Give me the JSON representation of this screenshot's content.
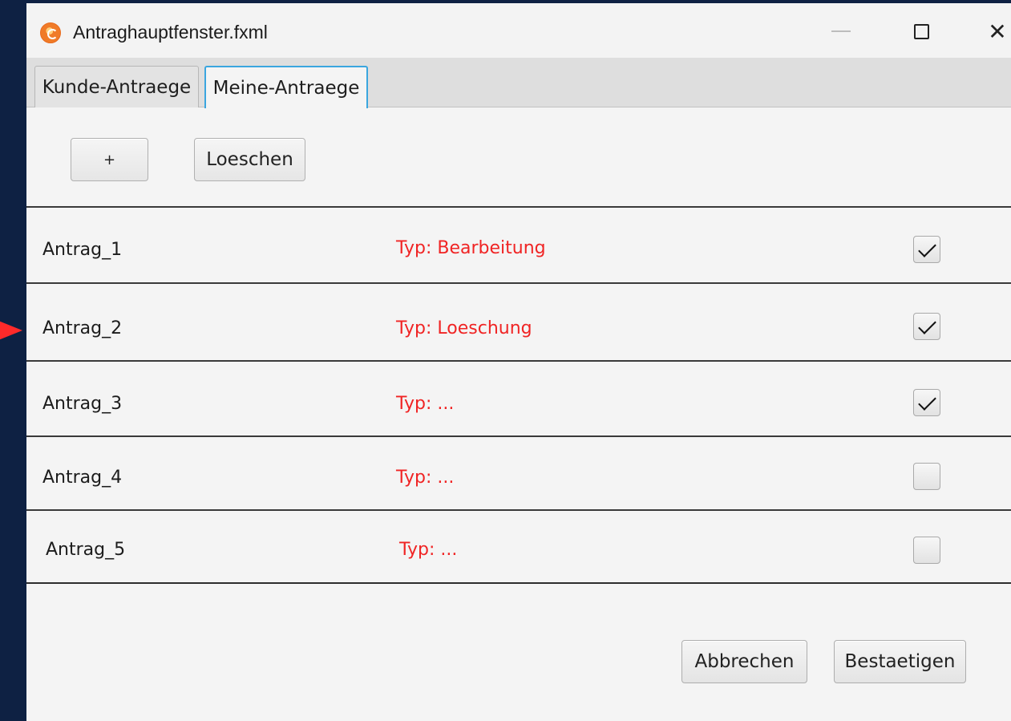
{
  "window": {
    "title": "Antraghauptfenster.fxml",
    "icon": "app-logo-icon",
    "controls": {
      "minimize_icon": "minimize-icon",
      "maximize_icon": "maximize-icon",
      "close_label": "✕"
    }
  },
  "tabs": [
    {
      "label": "Kunde-Antraege",
      "selected": false
    },
    {
      "label": "Meine-Antraege",
      "selected": true
    }
  ],
  "toolbar": {
    "add_label": "+",
    "delete_label": "Loeschen"
  },
  "list": {
    "items": [
      {
        "name": "Antrag_1",
        "type": "Typ:  Bearbeitung",
        "checked": true
      },
      {
        "name": "Antrag_2",
        "type": "Typ:  Loeschung",
        "checked": true
      },
      {
        "name": "Antrag_3",
        "type": "Typ:  ...",
        "checked": true
      },
      {
        "name": "Antrag_4",
        "type": "Typ:  ...",
        "checked": false
      },
      {
        "name": "Antrag_5",
        "type": "Typ:  ...",
        "checked": false
      }
    ]
  },
  "footer": {
    "cancel_label": "Abbrechen",
    "confirm_label": "Bestaetigen"
  },
  "colors": {
    "type_text": "#f02424",
    "selected_tab_border": "#3aa6df",
    "desktop_background": "#0e2143",
    "pointer_arrow": "#ff2a2a"
  }
}
